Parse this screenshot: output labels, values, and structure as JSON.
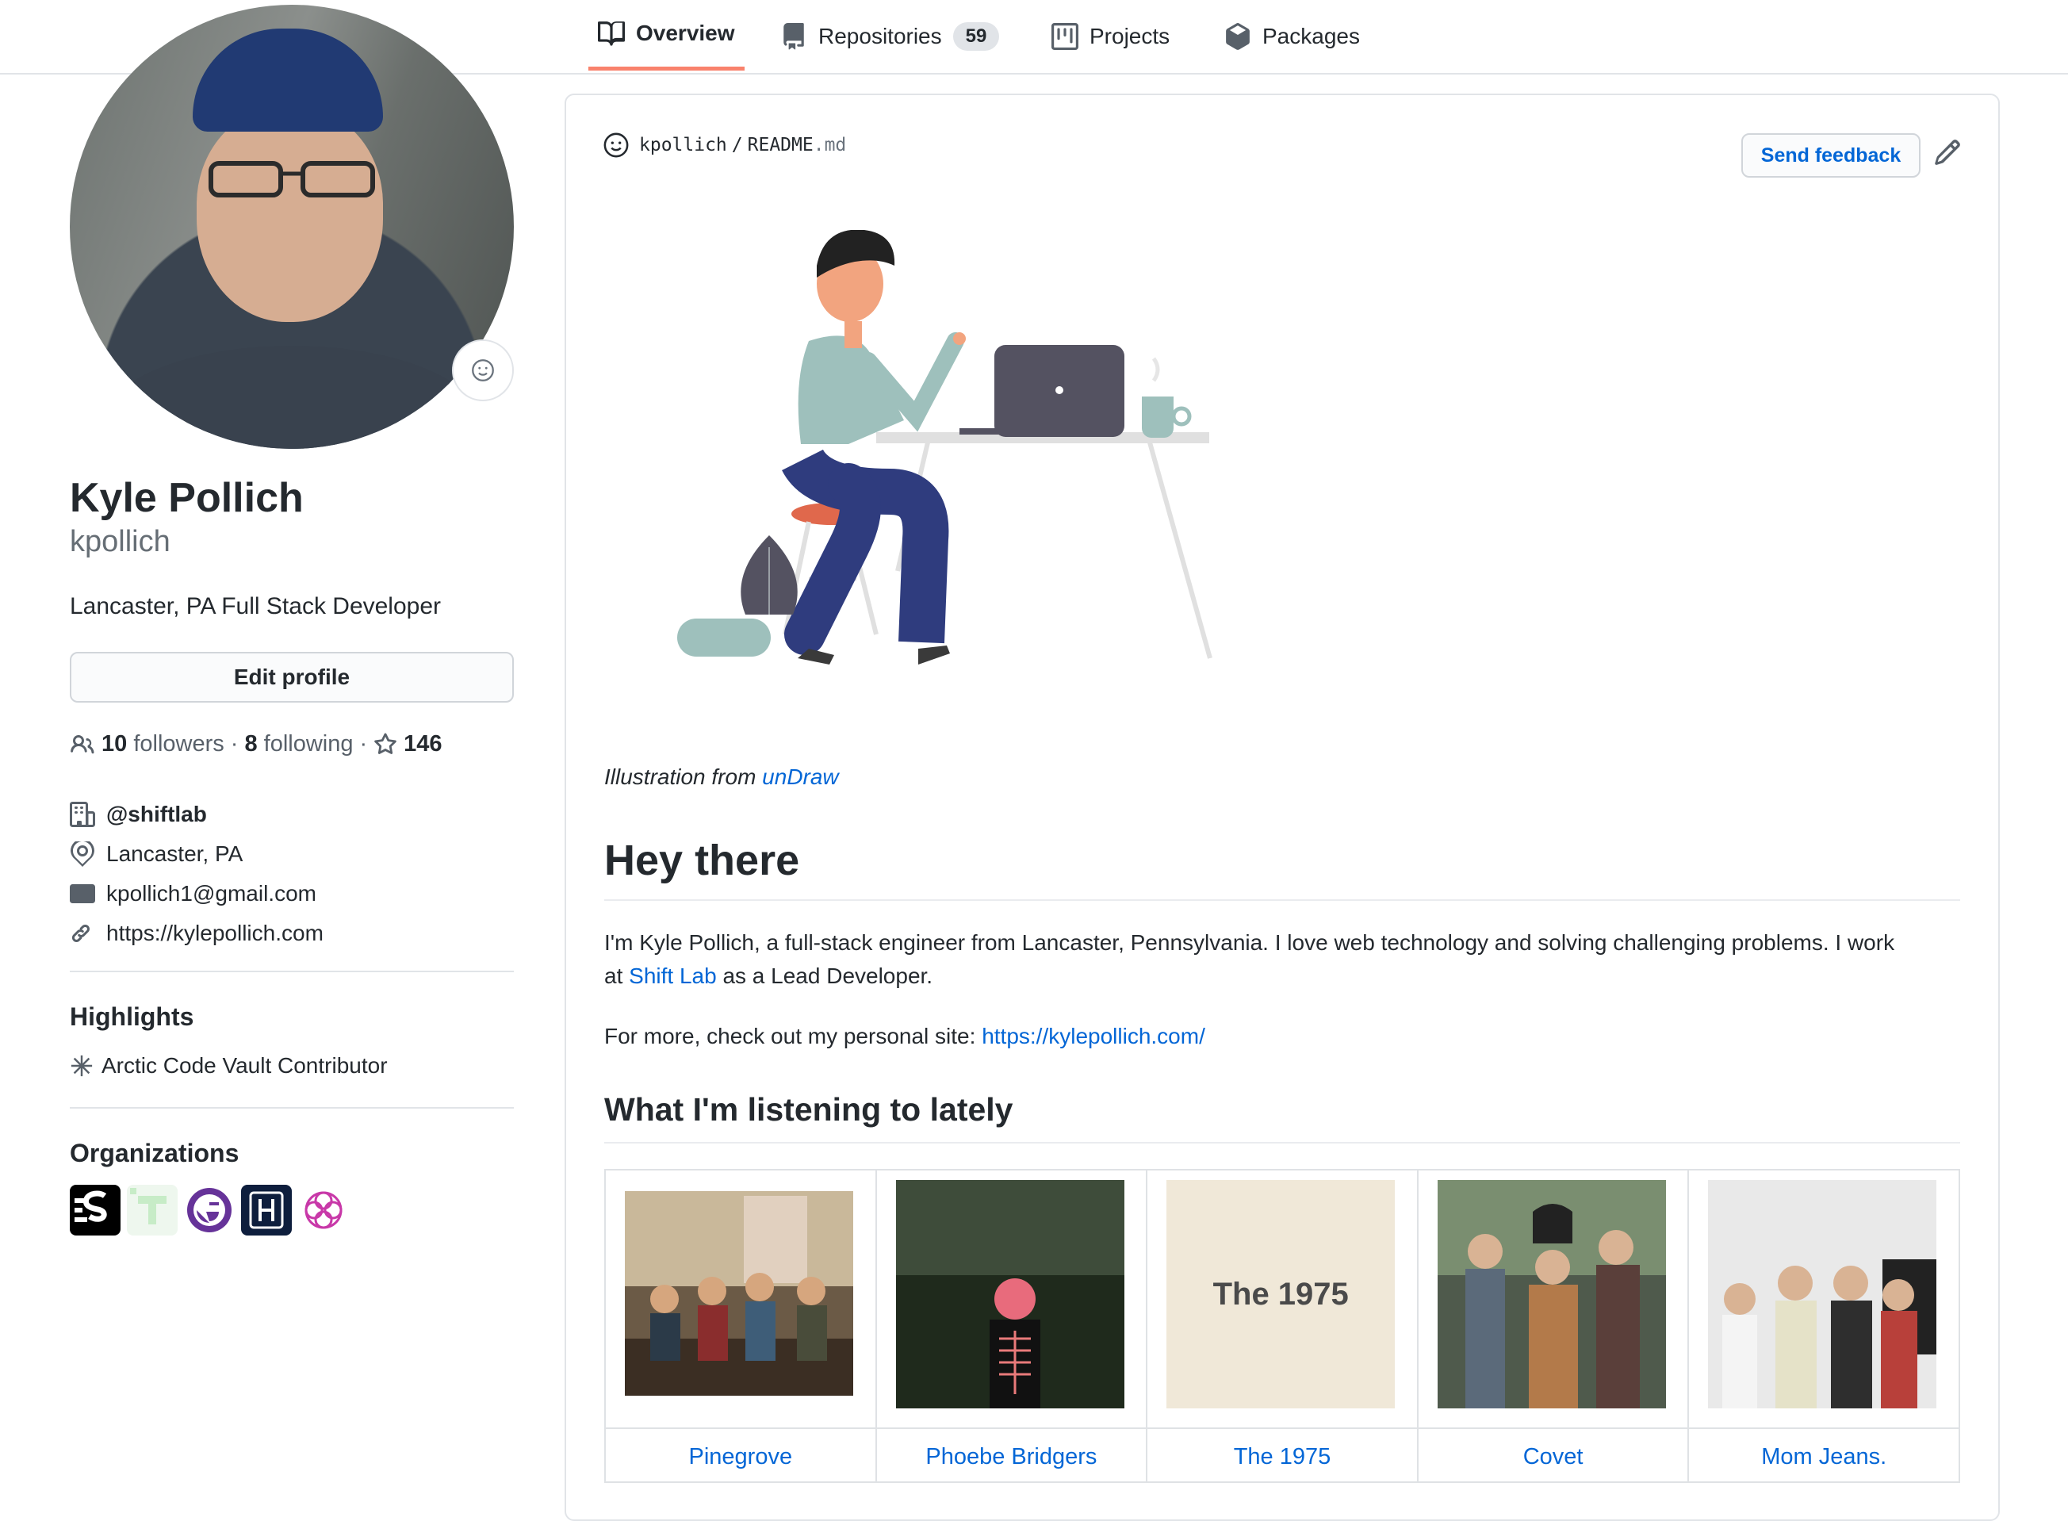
{
  "nav": {
    "tabs": [
      {
        "label": "Overview",
        "icon": "book-icon",
        "active": true
      },
      {
        "label": "Repositories",
        "icon": "repo-icon",
        "count": "59"
      },
      {
        "label": "Projects",
        "icon": "project-icon"
      },
      {
        "label": "Packages",
        "icon": "package-icon"
      }
    ],
    "accent": "#f9826c"
  },
  "profile": {
    "name": "Kyle Pollich",
    "login": "kpollich",
    "bio": "Lancaster, PA Full Stack Developer",
    "edit_label": "Edit profile",
    "followers_count": "10",
    "followers_label": "followers",
    "following_count": "8",
    "following_label": "following",
    "stars_count": "146",
    "sep": "·",
    "company": "@shiftlab",
    "location": "Lancaster, PA",
    "email": "kpollich1@gmail.com",
    "website": "https://kylepollich.com"
  },
  "highlights": {
    "title": "Highlights",
    "items": [
      "Arctic Code Vault Contributor"
    ]
  },
  "organizations": {
    "title": "Organizations"
  },
  "readme": {
    "owner": "kpollich",
    "slash": "/",
    "file": "README",
    "ext": ".md",
    "feedback_label": "Send feedback",
    "caption_prefix": "Illustration from ",
    "caption_link": "unDraw",
    "heading": "Hey there",
    "para1_a": "I'm Kyle Pollich, a full-stack engineer from Lancaster, Pennsylvania. I love web technology and solving challenging problems. I work",
    "para1_b": "at ",
    "para1_link": "Shift Lab",
    "para1_c": " as a Lead Developer.",
    "para2_prefix": "For more, check out my personal site: ",
    "para2_link": "https://kylepollich.com/",
    "listening_heading": "What I'm listening to lately",
    "albums": [
      {
        "name": "Pinegrove"
      },
      {
        "name": "Phoebe Bridgers"
      },
      {
        "name": "The 1975",
        "art_text": "The 1975"
      },
      {
        "name": "Covet"
      },
      {
        "name": "Mom Jeans."
      }
    ]
  },
  "colors": {
    "link": "#0366d6",
    "text": "#24292e",
    "muted": "#586069",
    "border": "#e1e4e8"
  }
}
